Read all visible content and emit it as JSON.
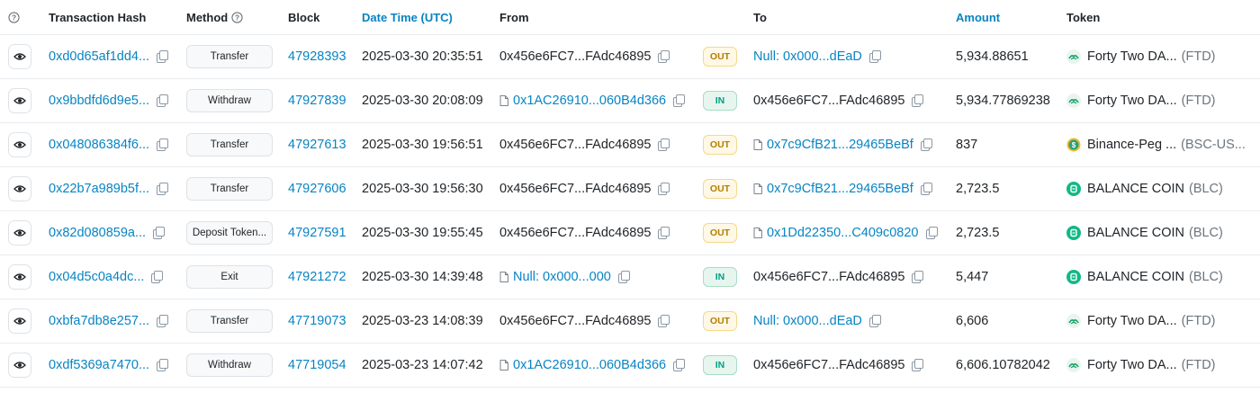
{
  "headers": {
    "hash": "Transaction Hash",
    "method": "Method",
    "block": "Block",
    "date": "Date Time (UTC)",
    "from": "From",
    "to": "To",
    "amount": "Amount",
    "token": "Token"
  },
  "colors": {
    "link": "#0784c3",
    "out": "#b47d00",
    "in": "#00a186"
  },
  "rows": [
    {
      "hash": "0xd0d65af1dd4...",
      "method": "Transfer",
      "block": "47928393",
      "date": "2025-03-30 20:35:51",
      "from": "0x456e6FC7...FAdc46895",
      "from_link": false,
      "from_doc": false,
      "dir": "OUT",
      "to": "Null: 0x000...dEaD",
      "to_link": true,
      "to_doc": false,
      "amount": "5,934.88651",
      "token": "Forty Two DA...",
      "symbol": "(FTD)",
      "token_icon": "ftd-icon"
    },
    {
      "hash": "0x9bbdfd6d9e5...",
      "method": "Withdraw",
      "block": "47927839",
      "date": "2025-03-30 20:08:09",
      "from": "0x1AC26910...060B4d366",
      "from_link": true,
      "from_doc": true,
      "dir": "IN",
      "to": "0x456e6FC7...FAdc46895",
      "to_link": false,
      "to_doc": false,
      "amount": "5,934.77869238",
      "token": "Forty Two DA...",
      "symbol": "(FTD)",
      "token_icon": "ftd-icon"
    },
    {
      "hash": "0x048086384f6...",
      "method": "Transfer",
      "block": "47927613",
      "date": "2025-03-30 19:56:51",
      "from": "0x456e6FC7...FAdc46895",
      "from_link": false,
      "from_doc": false,
      "dir": "OUT",
      "to": "0x7c9CfB21...29465BeBf",
      "to_link": true,
      "to_doc": true,
      "amount": "837",
      "token": "Binance-Peg ...",
      "symbol": "(BSC-US...",
      "token_icon": "usd-icon"
    },
    {
      "hash": "0x22b7a989b5f...",
      "method": "Transfer",
      "block": "47927606",
      "date": "2025-03-30 19:56:30",
      "from": "0x456e6FC7...FAdc46895",
      "from_link": false,
      "from_doc": false,
      "dir": "OUT",
      "to": "0x7c9CfB21...29465BeBf",
      "to_link": true,
      "to_doc": true,
      "amount": "2,723.5",
      "token": "BALANCE COIN",
      "symbol": "(BLC)",
      "token_icon": "blc-icon"
    },
    {
      "hash": "0x82d080859a...",
      "method": "Deposit Token...",
      "block": "47927591",
      "date": "2025-03-30 19:55:45",
      "from": "0x456e6FC7...FAdc46895",
      "from_link": false,
      "from_doc": false,
      "dir": "OUT",
      "to": "0x1Dd22350...C409c0820",
      "to_link": true,
      "to_doc": true,
      "amount": "2,723.5",
      "token": "BALANCE COIN",
      "symbol": "(BLC)",
      "token_icon": "blc-icon"
    },
    {
      "hash": "0x04d5c0a4dc...",
      "method": "Exit",
      "block": "47921272",
      "date": "2025-03-30 14:39:48",
      "from": "Null: 0x000...000",
      "from_link": true,
      "from_doc": true,
      "dir": "IN",
      "to": "0x456e6FC7...FAdc46895",
      "to_link": false,
      "to_doc": false,
      "amount": "5,447",
      "token": "BALANCE COIN",
      "symbol": "(BLC)",
      "token_icon": "blc-icon"
    },
    {
      "hash": "0xbfa7db8e257...",
      "method": "Transfer",
      "block": "47719073",
      "date": "2025-03-23 14:08:39",
      "from": "0x456e6FC7...FAdc46895",
      "from_link": false,
      "from_doc": false,
      "dir": "OUT",
      "to": "Null: 0x000...dEaD",
      "to_link": true,
      "to_doc": false,
      "amount": "6,606",
      "token": "Forty Two DA...",
      "symbol": "(FTD)",
      "token_icon": "ftd-icon"
    },
    {
      "hash": "0xdf5369a7470...",
      "method": "Withdraw",
      "block": "47719054",
      "date": "2025-03-23 14:07:42",
      "from": "0x1AC26910...060B4d366",
      "from_link": true,
      "from_doc": true,
      "dir": "IN",
      "to": "0x456e6FC7...FAdc46895",
      "to_link": false,
      "to_doc": false,
      "amount": "6,606.10782042",
      "token": "Forty Two DA...",
      "symbol": "(FTD)",
      "token_icon": "ftd-icon"
    }
  ]
}
